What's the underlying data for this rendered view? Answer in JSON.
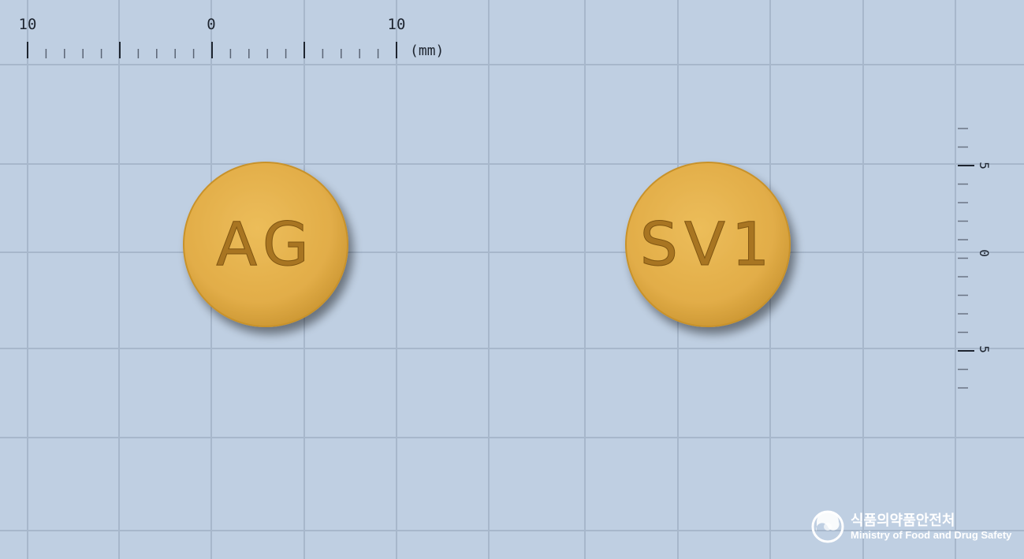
{
  "colors": {
    "background": "#bfcfe2",
    "grid_line": "#a7b7cb",
    "ruler_ink": "#1e2530",
    "tablet_fill": "#e3b04b",
    "tablet_edge": "#c8922c",
    "imprint_ink": "#9c6c1a",
    "logo_white": "#ffffff"
  },
  "ruler_top": {
    "labels": [
      "10",
      "0",
      "10"
    ],
    "unit": "(mm)"
  },
  "ruler_right": {
    "labels": [
      "5",
      "0",
      "5"
    ]
  },
  "tablets": [
    {
      "imprint": "AG",
      "face": "front"
    },
    {
      "imprint": "SV1",
      "face": "back"
    }
  ],
  "watermark": {
    "org_korean": "식품의약품안전처",
    "org_english": "Ministry of Food and Drug Safety",
    "emblem_icon": "mfds-taeguk-emblem-icon"
  }
}
